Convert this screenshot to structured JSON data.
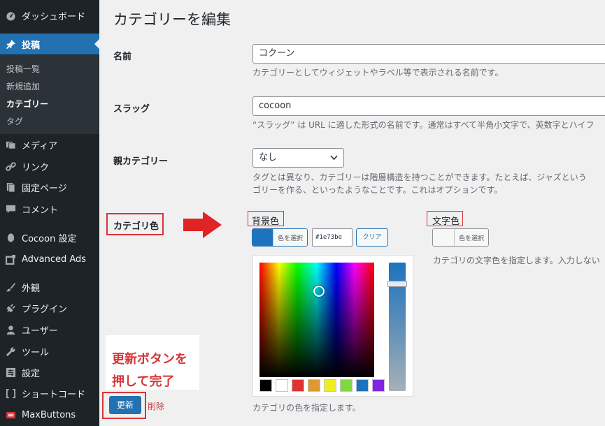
{
  "sidebar": {
    "items": [
      {
        "label": "ダッシュボード",
        "icon": "dashboard-icon"
      },
      {
        "label": "投稿",
        "icon": "pushpin-icon",
        "active": true
      },
      {
        "label": "メディア",
        "icon": "media-icon"
      },
      {
        "label": "リンク",
        "icon": "link-icon"
      },
      {
        "label": "固定ページ",
        "icon": "page-icon"
      },
      {
        "label": "コメント",
        "icon": "comment-icon"
      },
      {
        "label": "Cocoon 設定",
        "icon": "cocoon-icon"
      },
      {
        "label": "Advanced Ads",
        "icon": "ads-icon"
      },
      {
        "label": "外観",
        "icon": "paintbrush-icon"
      },
      {
        "label": "プラグイン",
        "icon": "plugin-icon"
      },
      {
        "label": "ユーザー",
        "icon": "user-icon"
      },
      {
        "label": "ツール",
        "icon": "wrench-icon"
      },
      {
        "label": "設定",
        "icon": "settings-icon"
      },
      {
        "label": "ショートコード",
        "icon": "shortcode-icon"
      },
      {
        "label": "MaxButtons",
        "icon": "maxbuttons-icon"
      }
    ],
    "submenu": [
      "投稿一覧",
      "新規追加",
      "カテゴリー",
      "タグ"
    ]
  },
  "page": {
    "title": "カテゴリーを編集",
    "name_label": "名前",
    "name_value": "コクーン",
    "name_desc": "カテゴリーとしてウィジェットやラベル等で表示される名前です。",
    "slug_label": "スラッグ",
    "slug_value": "cocoon",
    "slug_desc": "“スラッグ” は URL に適した形式の名前です。通常はすべて半角小文字で、英数字とハイフ",
    "parent_label": "親カテゴリー",
    "parent_value": "なし",
    "parent_desc_1": "タグとは異なり、カテゴリーは階層構造を持つことができます。たとえば、ジャズという",
    "parent_desc_2": "ゴリーを作る、といったようなことです。これはオプションです。",
    "color_label": "カテゴリ色",
    "bg_color_title": "背景色",
    "select_color_label": "色を選択",
    "hex_value": "#1e73be",
    "clear_label": "クリア",
    "text_color_title": "文字色",
    "text_color_select_label": "色を選択",
    "text_color_desc": "カテゴリの文字色を指定します。入力しない",
    "bg_color_desc": "カテゴリの色を指定します。",
    "callout_line1": "更新ボタンを",
    "callout_line2": "押して完了",
    "update_label": "更新",
    "delete_label": "削除"
  },
  "colors": {
    "bg_swatch": "#1e73be",
    "palette": [
      "#000000",
      "#ffffff",
      "#dd3333",
      "#dd9933",
      "#eeee22",
      "#81d742",
      "#1e73be",
      "#8224e3"
    ]
  }
}
